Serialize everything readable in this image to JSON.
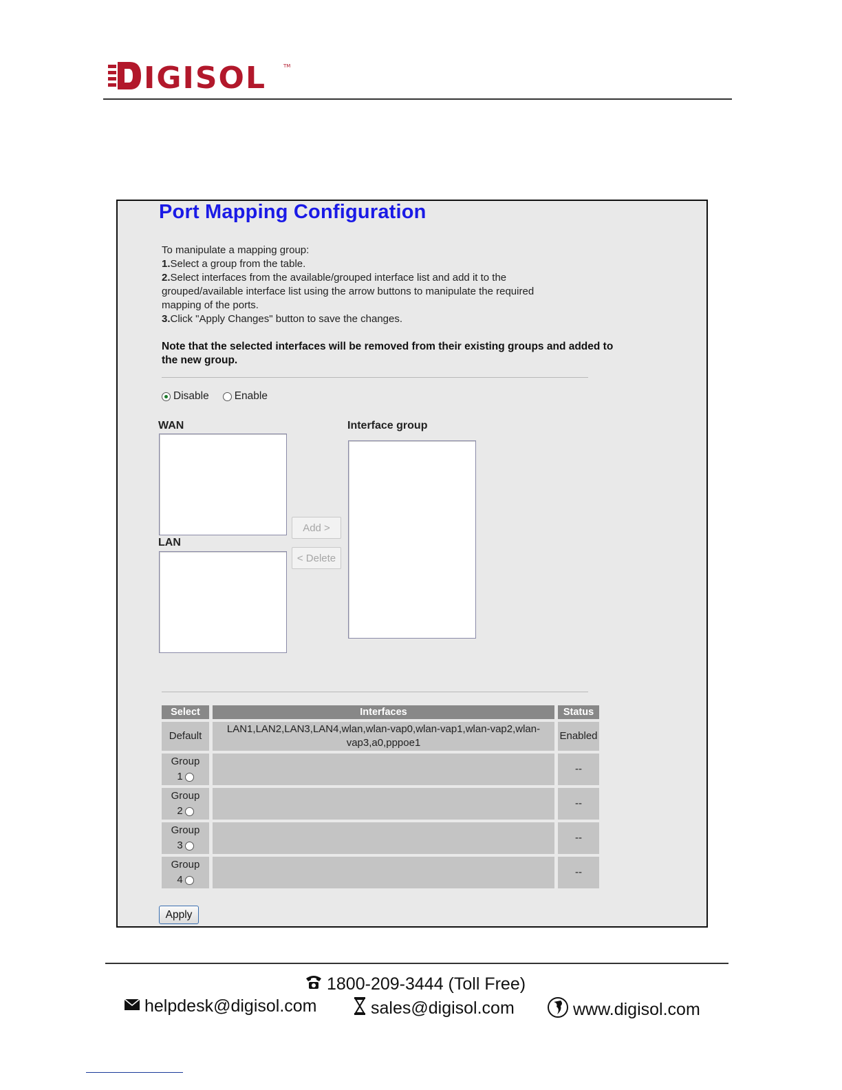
{
  "brand": {
    "name": "DIGISOL",
    "tm": "™",
    "logo_color": "#b2182b"
  },
  "form": {
    "title": "Port Mapping Configuration",
    "intro": "To manipulate a mapping group:",
    "step1_num": "1.",
    "step1": "Select a group from the table.",
    "step2_num": "2.",
    "step2": "Select interfaces from the available/grouped interface list and add it to the grouped/available interface list using the arrow buttons to manipulate the required mapping of the ports.",
    "step3_num": "3.",
    "step3": "Click \"Apply Changes\" button to save the changes.",
    "note": "Note that the selected interfaces will be removed from their existing groups and added to the new group.",
    "mode": {
      "options": [
        "Disable",
        "Enable"
      ],
      "selected": "Disable"
    },
    "wan_label": "WAN",
    "lan_label": "LAN",
    "group_label": "Interface group",
    "add_button": "Add >",
    "delete_button": "< Delete",
    "apply_button": "Apply",
    "table": {
      "headers": [
        "Select",
        "Interfaces",
        "Status"
      ],
      "rows": [
        {
          "select": "Default",
          "interfaces": "LAN1,LAN2,LAN3,LAN4,wlan,wlan-vap0,wlan-vap1,wlan-vap2,wlan-vap3,a0,pppoe1",
          "status": "Enabled"
        },
        {
          "select_word": "Group",
          "select_num": "1",
          "interfaces": "",
          "status": "--"
        },
        {
          "select_word": "Group",
          "select_num": "2",
          "interfaces": "",
          "status": "--"
        },
        {
          "select_word": "Group",
          "select_num": "3",
          "interfaces": "",
          "status": "--"
        },
        {
          "select_word": "Group",
          "select_num": "4",
          "interfaces": "",
          "status": "--"
        }
      ]
    },
    "colors": {
      "title": "#1a1ae6",
      "header_bg": "#888888",
      "cell_bg": "#c4c4c4",
      "panel_bg": "#e9e9e9"
    }
  },
  "footer": {
    "phone": "1800-209-3444 (Toll Free)",
    "helpdesk": "helpdesk@digisol.com",
    "sales": "sales@digisol.com",
    "website": "www.digisol.com",
    "icons": [
      "phone-icon",
      "envelope-icon",
      "hourglass-icon",
      "globe-icon"
    ]
  }
}
